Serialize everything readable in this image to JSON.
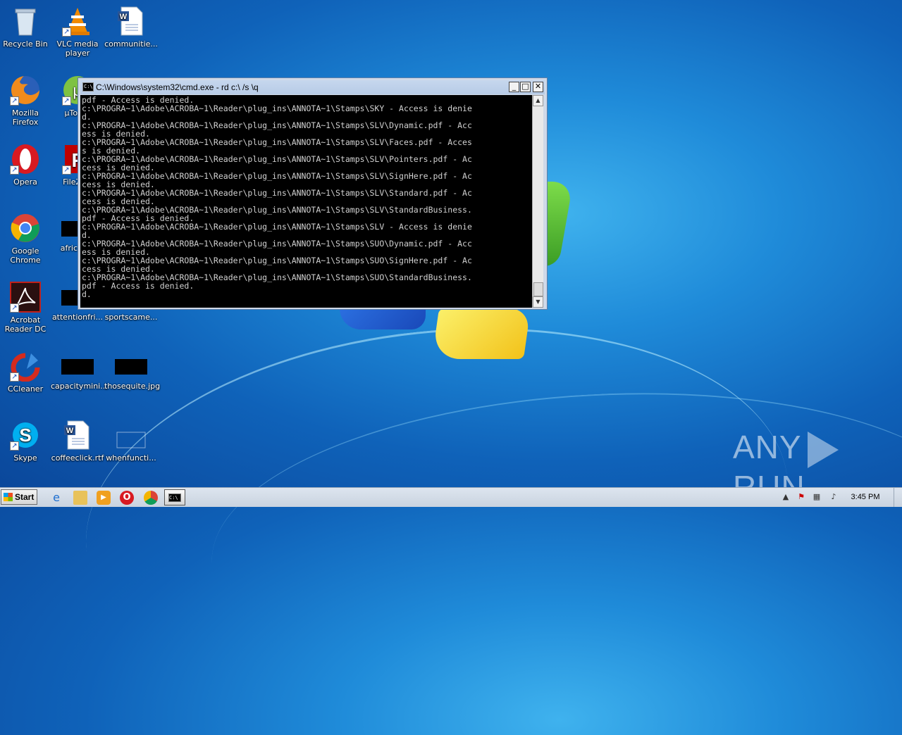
{
  "desktop": {
    "icons": [
      {
        "label": "Recycle Bin"
      },
      {
        "label": "VLC media player"
      },
      {
        "label": "communitie..."
      },
      {
        "label": "Mozilla Firefox"
      },
      {
        "label": "µTorr..."
      },
      {
        "label": "Opera"
      },
      {
        "label": "FileZilla"
      },
      {
        "label": "Google Chrome"
      },
      {
        "label": "africau..."
      },
      {
        "label": "Acrobat Reader DC"
      },
      {
        "label": "attentionfri..."
      },
      {
        "label": "sportscame..."
      },
      {
        "label": "CCleaner"
      },
      {
        "label": "capacitymini..."
      },
      {
        "label": "thosequite.jpg"
      },
      {
        "label": "Skype"
      },
      {
        "label": "coffeeclick.rtf"
      },
      {
        "label": "whenfuncti..."
      }
    ]
  },
  "cmd_window": {
    "title": "C:\\Windows\\system32\\cmd.exe - rd  c:\\ /s \\q",
    "minimize": "_",
    "maximize": "□",
    "close": "✕",
    "lines": [
      "pdf - Access is denied.",
      "c:\\PROGRA~1\\Adobe\\ACROBA~1\\Reader\\plug_ins\\ANNOTA~1\\Stamps\\SKY - Access is denie",
      "d.",
      "c:\\PROGRA~1\\Adobe\\ACROBA~1\\Reader\\plug_ins\\ANNOTA~1\\Stamps\\SLV\\Dynamic.pdf - Acc",
      "ess is denied.",
      "c:\\PROGRA~1\\Adobe\\ACROBA~1\\Reader\\plug_ins\\ANNOTA~1\\Stamps\\SLV\\Faces.pdf - Acces",
      "s is denied.",
      "c:\\PROGRA~1\\Adobe\\ACROBA~1\\Reader\\plug_ins\\ANNOTA~1\\Stamps\\SLV\\Pointers.pdf - Ac",
      "cess is denied.",
      "c:\\PROGRA~1\\Adobe\\ACROBA~1\\Reader\\plug_ins\\ANNOTA~1\\Stamps\\SLV\\SignHere.pdf - Ac",
      "cess is denied.",
      "c:\\PROGRA~1\\Adobe\\ACROBA~1\\Reader\\plug_ins\\ANNOTA~1\\Stamps\\SLV\\Standard.pdf - Ac",
      "cess is denied.",
      "c:\\PROGRA~1\\Adobe\\ACROBA~1\\Reader\\plug_ins\\ANNOTA~1\\Stamps\\SLV\\StandardBusiness.",
      "pdf - Access is denied.",
      "c:\\PROGRA~1\\Adobe\\ACROBA~1\\Reader\\plug_ins\\ANNOTA~1\\Stamps\\SLV - Access is denie",
      "d.",
      "c:\\PROGRA~1\\Adobe\\ACROBA~1\\Reader\\plug_ins\\ANNOTA~1\\Stamps\\SUO\\Dynamic.pdf - Acc",
      "ess is denied.",
      "c:\\PROGRA~1\\Adobe\\ACROBA~1\\Reader\\plug_ins\\ANNOTA~1\\Stamps\\SUO\\SignHere.pdf - Ac",
      "cess is denied.",
      "c:\\PROGRA~1\\Adobe\\ACROBA~1\\Reader\\plug_ins\\ANNOTA~1\\Stamps\\SUO\\StandardBusiness.",
      "pdf - Access is denied.",
      "d."
    ]
  },
  "watermark": {
    "left": "ANY",
    "right": "RUN"
  },
  "taskbar": {
    "start_label": "Start",
    "clock": "3:45 PM"
  },
  "colors": {
    "desktop_blue": "#0f62b9",
    "console_bg": "#000000",
    "console_text": "#d0d0d0"
  }
}
